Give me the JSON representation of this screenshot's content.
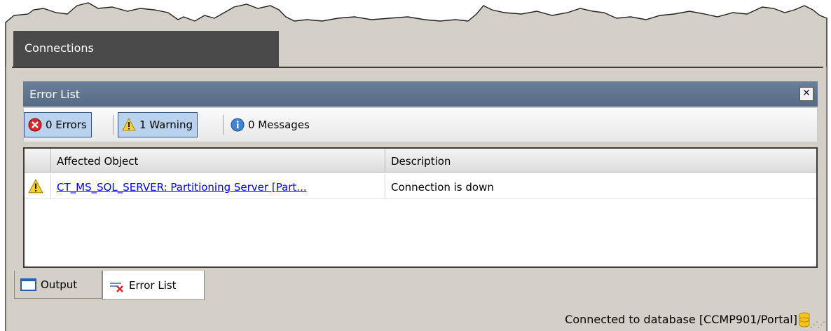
{
  "connections_tab": {
    "label": "Connections"
  },
  "panel": {
    "title": "Error List",
    "close_label": "✕"
  },
  "filters": {
    "errors": {
      "label": "0 Errors",
      "icon": "error-icon"
    },
    "warnings": {
      "label": "1 Warning",
      "icon": "warning-icon"
    },
    "messages": {
      "label": "0 Messages",
      "icon": "info-icon"
    }
  },
  "grid": {
    "columns": [
      "",
      "Affected Object",
      "Description"
    ],
    "rows": [
      {
        "icon": "warning-icon",
        "affected_object": "CT_MS_SQL_SERVER: Partitioning Server [Part...",
        "description": "Connection is down"
      }
    ]
  },
  "bottom_tabs": [
    {
      "label": "Output",
      "icon": "output-window-icon"
    },
    {
      "label": "Error List",
      "icon": "error-list-icon"
    }
  ],
  "status": {
    "text": "Connected to database [CCMP901/Portal]",
    "icon": "database-icon"
  },
  "colors": {
    "panel_header": "#566b87",
    "pressed_button": "#b9d3ee",
    "link": "#0000ee",
    "chrome": "#d4d0c8"
  }
}
